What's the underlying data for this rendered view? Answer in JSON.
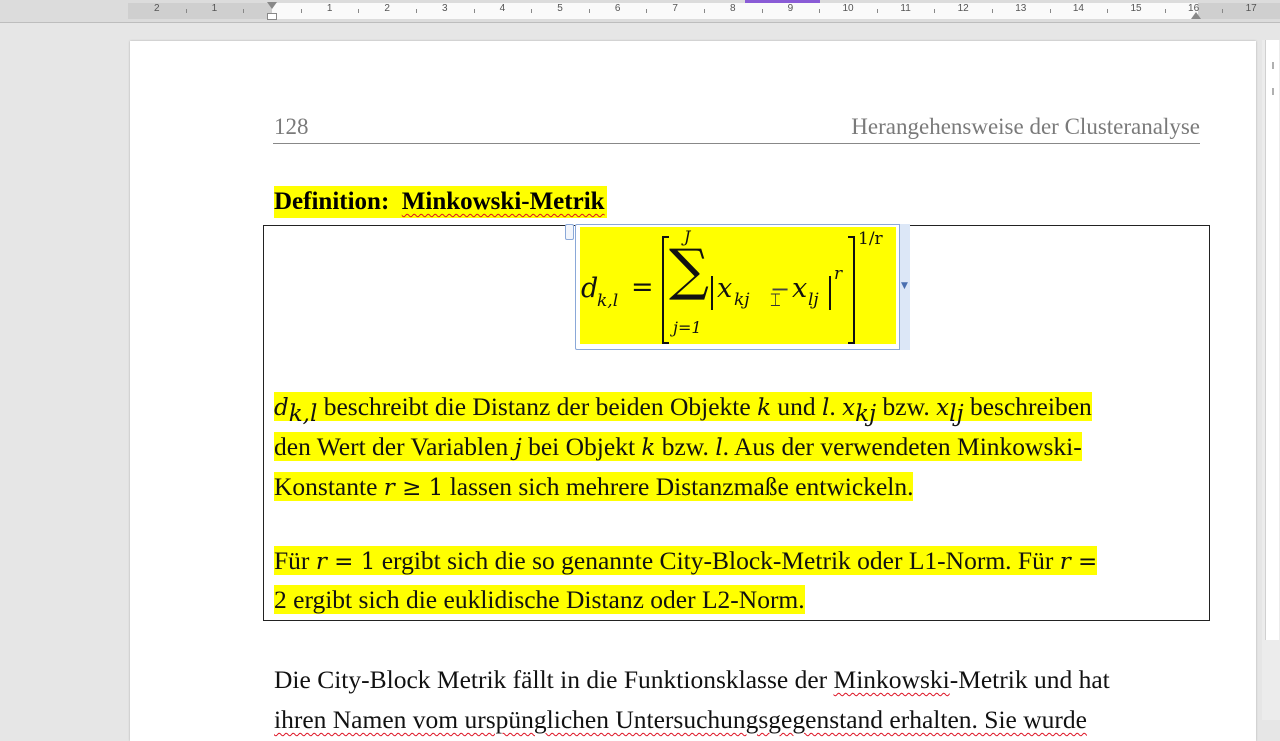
{
  "ruler": {
    "numbers": [
      "2",
      "1",
      "1",
      "2",
      "3",
      "4",
      "5",
      "6",
      "7",
      "8",
      "9",
      "10",
      "11",
      "12",
      "13",
      "14",
      "15",
      "16",
      "17"
    ]
  },
  "header": {
    "page_number": "128",
    "title": "Herangehensweise der Clusteranalyse"
  },
  "definition": {
    "label": "Definition:",
    "term": "Minkowski-Metrik",
    "formula": {
      "lhs": "d",
      "lhs_sub": "k,l",
      "equals": "=",
      "sum_upper": "J",
      "sum_lower": "j=1",
      "sum_symbol": "∑",
      "term_a": "x",
      "term_a_sub": "kj",
      "minus": "−",
      "term_b": "x",
      "term_b_sub": "lj",
      "abs_power": "r",
      "outer_power": "1/r"
    },
    "p1": {
      "l1": {
        "d": "d",
        "d_sub": "k,l",
        "t1": " beschreibt die Distanz der beiden Objekte ",
        "k": "k",
        "t2": " und ",
        "l": "l",
        "t3": ". ",
        "x1": "x",
        "x1_sub": "kj",
        "t4": " bzw. ",
        "x2": "x",
        "x2_sub": "lj",
        "t5": " beschreiben"
      },
      "l2": {
        "t1": "den Wert der Variablen ",
        "j": "j",
        "t2": " bei Objekt ",
        "k": "k",
        "t3": " bzw. ",
        "l": "l",
        "t4": ". Aus der verwendeten Minkowski-"
      },
      "l3": {
        "t1": "Konstante ",
        "r": "r",
        "ge": " ≥ 1",
        "t2": " lassen sich mehrere Distanzmaße entwickeln."
      }
    },
    "p2": {
      "l1": {
        "t1": "Für ",
        "r": "r",
        "eq": " = 1",
        "t2": " ergibt sich die so genannte City-Block-Metrik oder L1-Norm. Für ",
        "r2": "r",
        "eq2": " ="
      },
      "l2": {
        "t1": "2 ergibt sich die euklidische Distanz oder L2-Norm."
      }
    }
  },
  "body": {
    "l1_a": "Die City-Block Metrik fällt in die Funktionsklasse der ",
    "l1_term": "Minkowski",
    "l1_b": "-Metrik und hat",
    "l2": "ihren Namen vom urspünglichen Untersuchungsgegenstand erhalten. Sie wurde"
  },
  "colors": {
    "highlight": "#ffff00",
    "header_text": "#7a7a7a",
    "spell_underline": "#dd1122"
  }
}
